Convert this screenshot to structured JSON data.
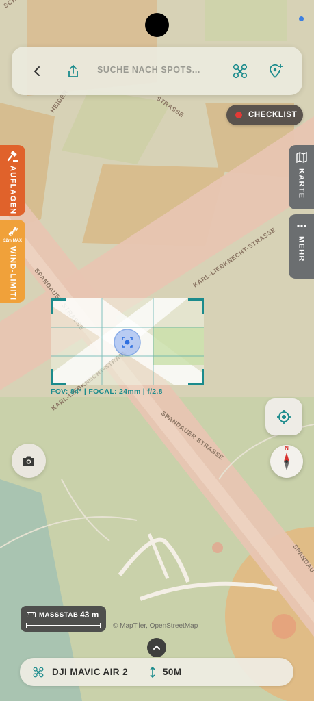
{
  "search": {
    "placeholder": "SUCHE NACH SPOTS..."
  },
  "checklist": {
    "label": "CHECKLIST"
  },
  "left_panel": {
    "restrictions_label": "AUFLAGEN",
    "wind_badge": "32m MAX",
    "wind_label": "WIND-LIMIT!"
  },
  "right_panel": {
    "map_label": "KARTE",
    "more_label": "MEHR"
  },
  "map": {
    "streets": [
      "KARL-LIEBKNECHT-STRASSE",
      "SPANDAUER STRASSE",
      "SPANDAUER STRASSE",
      "KARL-LIEBKNECHT-STRASSE",
      "SPANDAU",
      "HEIDER",
      "STRASSE",
      "SCH-STR"
    ],
    "attribution": "© MapTiler, OpenStreetMap"
  },
  "camera_overlay": {
    "info": "FOV: 84° | FOCAL: 24mm | f/2.8"
  },
  "compass": {
    "north": "N"
  },
  "scale": {
    "label": "MASSSTAB",
    "value": "43 m"
  },
  "bottom": {
    "drone": "DJI MAVIC AIR 2",
    "altitude": "50M"
  },
  "colors": {
    "accent": "#1b8b8c",
    "warning_orange": "#e0622b",
    "wind_yellow": "#f0a13a",
    "checklist_red": "#e23a36"
  },
  "icons": [
    "back-icon",
    "share-icon",
    "drone-icon",
    "add-location-icon",
    "gavel-icon",
    "wind-icon",
    "map-icon",
    "more-icon",
    "locate-icon",
    "camera-icon",
    "ruler-icon",
    "chevron-up-icon",
    "altitude-icon"
  ]
}
